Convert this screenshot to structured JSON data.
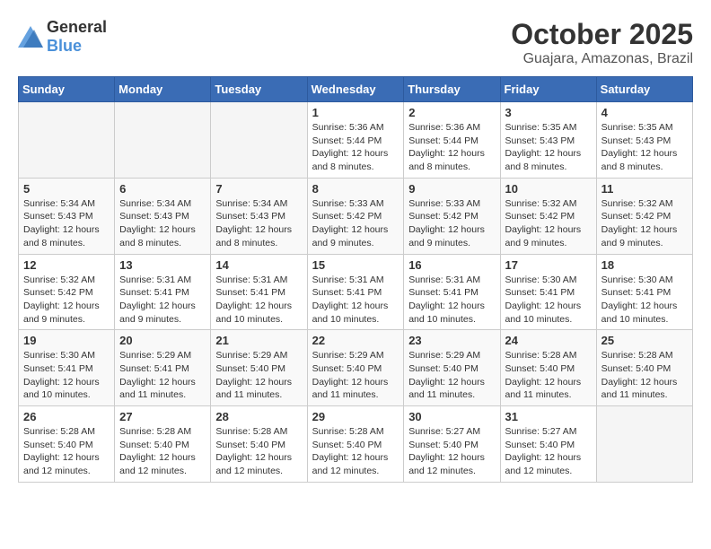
{
  "header": {
    "logo_general": "General",
    "logo_blue": "Blue",
    "month": "October 2025",
    "location": "Guajara, Amazonas, Brazil"
  },
  "weekdays": [
    "Sunday",
    "Monday",
    "Tuesday",
    "Wednesday",
    "Thursday",
    "Friday",
    "Saturday"
  ],
  "weeks": [
    [
      {
        "day": "",
        "info": ""
      },
      {
        "day": "",
        "info": ""
      },
      {
        "day": "",
        "info": ""
      },
      {
        "day": "1",
        "info": "Sunrise: 5:36 AM\nSunset: 5:44 PM\nDaylight: 12 hours\nand 8 minutes."
      },
      {
        "day": "2",
        "info": "Sunrise: 5:36 AM\nSunset: 5:44 PM\nDaylight: 12 hours\nand 8 minutes."
      },
      {
        "day": "3",
        "info": "Sunrise: 5:35 AM\nSunset: 5:43 PM\nDaylight: 12 hours\nand 8 minutes."
      },
      {
        "day": "4",
        "info": "Sunrise: 5:35 AM\nSunset: 5:43 PM\nDaylight: 12 hours\nand 8 minutes."
      }
    ],
    [
      {
        "day": "5",
        "info": "Sunrise: 5:34 AM\nSunset: 5:43 PM\nDaylight: 12 hours\nand 8 minutes."
      },
      {
        "day": "6",
        "info": "Sunrise: 5:34 AM\nSunset: 5:43 PM\nDaylight: 12 hours\nand 8 minutes."
      },
      {
        "day": "7",
        "info": "Sunrise: 5:34 AM\nSunset: 5:43 PM\nDaylight: 12 hours\nand 8 minutes."
      },
      {
        "day": "8",
        "info": "Sunrise: 5:33 AM\nSunset: 5:42 PM\nDaylight: 12 hours\nand 9 minutes."
      },
      {
        "day": "9",
        "info": "Sunrise: 5:33 AM\nSunset: 5:42 PM\nDaylight: 12 hours\nand 9 minutes."
      },
      {
        "day": "10",
        "info": "Sunrise: 5:32 AM\nSunset: 5:42 PM\nDaylight: 12 hours\nand 9 minutes."
      },
      {
        "day": "11",
        "info": "Sunrise: 5:32 AM\nSunset: 5:42 PM\nDaylight: 12 hours\nand 9 minutes."
      }
    ],
    [
      {
        "day": "12",
        "info": "Sunrise: 5:32 AM\nSunset: 5:42 PM\nDaylight: 12 hours\nand 9 minutes."
      },
      {
        "day": "13",
        "info": "Sunrise: 5:31 AM\nSunset: 5:41 PM\nDaylight: 12 hours\nand 9 minutes."
      },
      {
        "day": "14",
        "info": "Sunrise: 5:31 AM\nSunset: 5:41 PM\nDaylight: 12 hours\nand 10 minutes."
      },
      {
        "day": "15",
        "info": "Sunrise: 5:31 AM\nSunset: 5:41 PM\nDaylight: 12 hours\nand 10 minutes."
      },
      {
        "day": "16",
        "info": "Sunrise: 5:31 AM\nSunset: 5:41 PM\nDaylight: 12 hours\nand 10 minutes."
      },
      {
        "day": "17",
        "info": "Sunrise: 5:30 AM\nSunset: 5:41 PM\nDaylight: 12 hours\nand 10 minutes."
      },
      {
        "day": "18",
        "info": "Sunrise: 5:30 AM\nSunset: 5:41 PM\nDaylight: 12 hours\nand 10 minutes."
      }
    ],
    [
      {
        "day": "19",
        "info": "Sunrise: 5:30 AM\nSunset: 5:41 PM\nDaylight: 12 hours\nand 10 minutes."
      },
      {
        "day": "20",
        "info": "Sunrise: 5:29 AM\nSunset: 5:41 PM\nDaylight: 12 hours\nand 11 minutes."
      },
      {
        "day": "21",
        "info": "Sunrise: 5:29 AM\nSunset: 5:40 PM\nDaylight: 12 hours\nand 11 minutes."
      },
      {
        "day": "22",
        "info": "Sunrise: 5:29 AM\nSunset: 5:40 PM\nDaylight: 12 hours\nand 11 minutes."
      },
      {
        "day": "23",
        "info": "Sunrise: 5:29 AM\nSunset: 5:40 PM\nDaylight: 12 hours\nand 11 minutes."
      },
      {
        "day": "24",
        "info": "Sunrise: 5:28 AM\nSunset: 5:40 PM\nDaylight: 12 hours\nand 11 minutes."
      },
      {
        "day": "25",
        "info": "Sunrise: 5:28 AM\nSunset: 5:40 PM\nDaylight: 12 hours\nand 11 minutes."
      }
    ],
    [
      {
        "day": "26",
        "info": "Sunrise: 5:28 AM\nSunset: 5:40 PM\nDaylight: 12 hours\nand 12 minutes."
      },
      {
        "day": "27",
        "info": "Sunrise: 5:28 AM\nSunset: 5:40 PM\nDaylight: 12 hours\nand 12 minutes."
      },
      {
        "day": "28",
        "info": "Sunrise: 5:28 AM\nSunset: 5:40 PM\nDaylight: 12 hours\nand 12 minutes."
      },
      {
        "day": "29",
        "info": "Sunrise: 5:28 AM\nSunset: 5:40 PM\nDaylight: 12 hours\nand 12 minutes."
      },
      {
        "day": "30",
        "info": "Sunrise: 5:27 AM\nSunset: 5:40 PM\nDaylight: 12 hours\nand 12 minutes."
      },
      {
        "day": "31",
        "info": "Sunrise: 5:27 AM\nSunset: 5:40 PM\nDaylight: 12 hours\nand 12 minutes."
      },
      {
        "day": "",
        "info": ""
      }
    ]
  ]
}
